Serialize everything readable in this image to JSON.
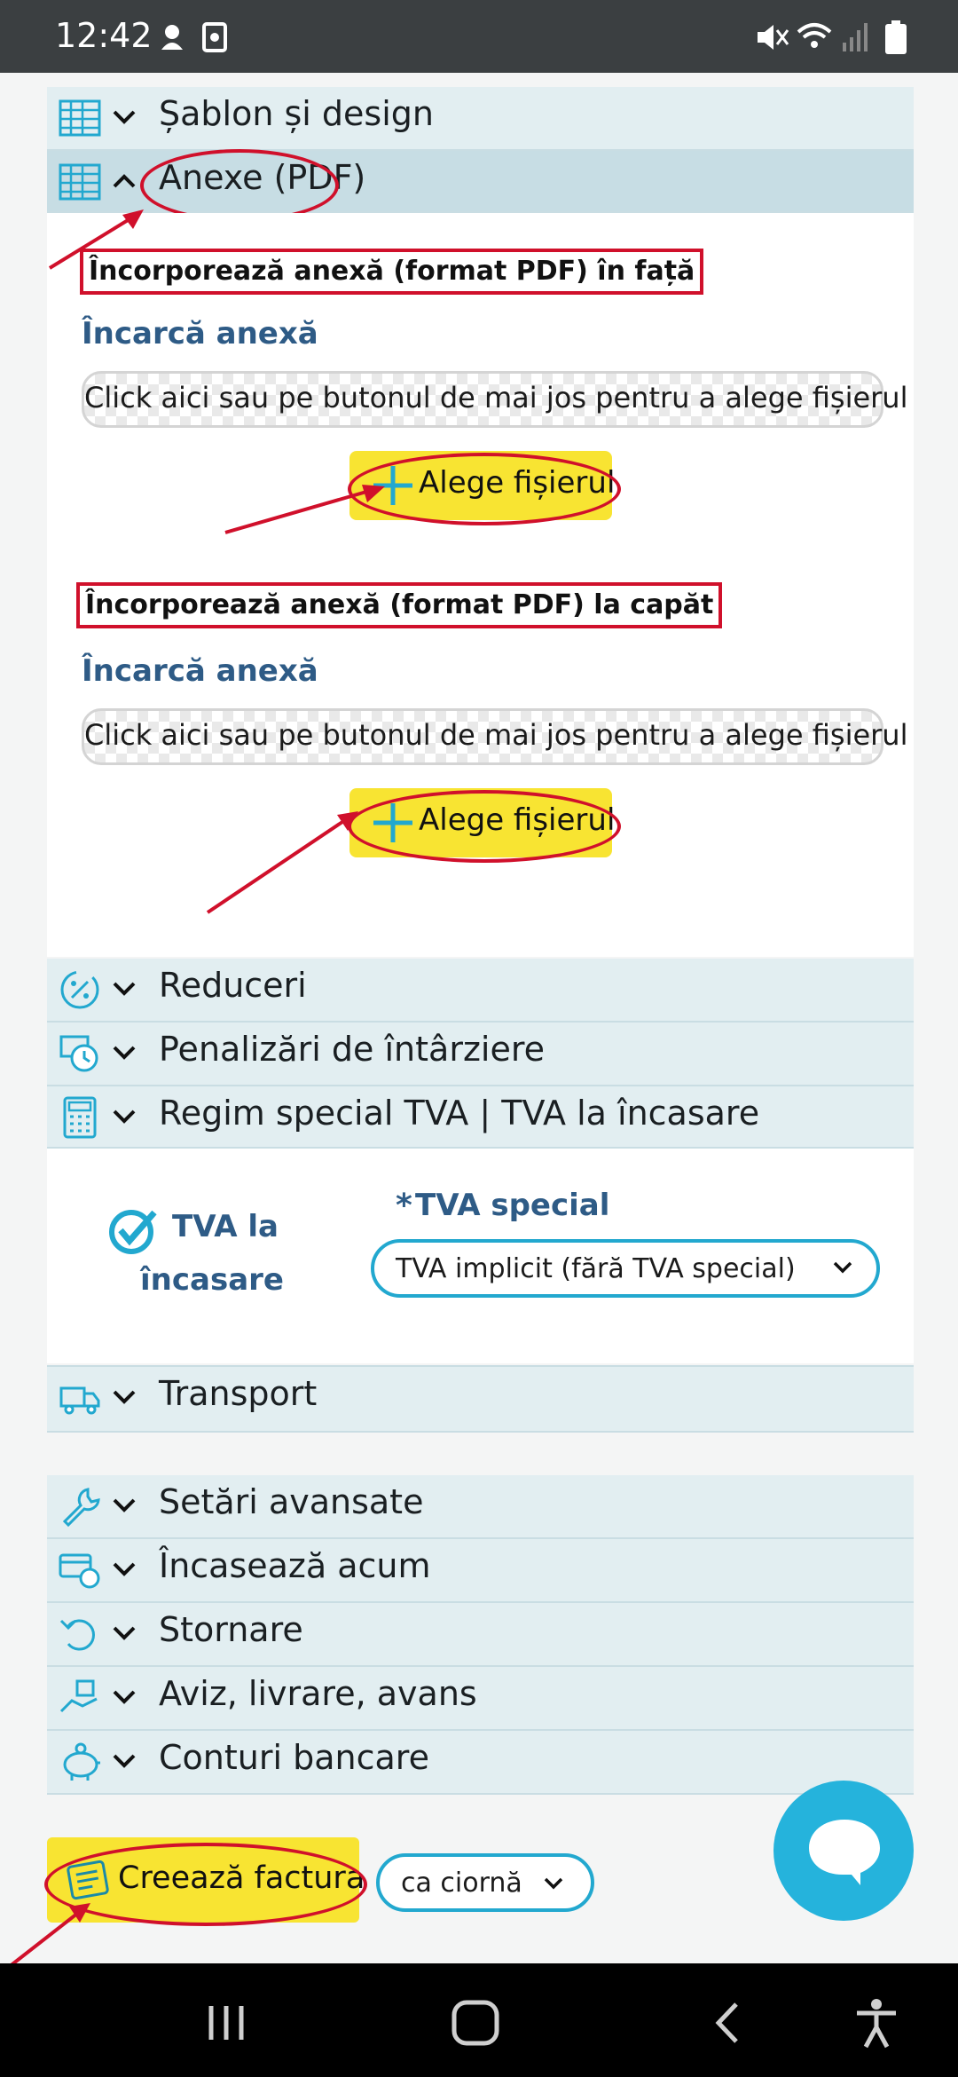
{
  "status_bar": {
    "time": "12:42"
  },
  "sections_top": [
    {
      "label": "Șablon și design",
      "icon": "table-icon"
    },
    {
      "label": "Anexe (PDF)",
      "icon": "table-icon"
    }
  ],
  "anexe": {
    "front_heading": "Încorporează anexă (format PDF) în față",
    "front_upload_label": "Încarcă anexă",
    "front_drop_text": "Click aici sau pe butonul de mai jos pentru a alege fișierul",
    "front_choose_button": "Alege fișierul",
    "end_heading": "Încorporează anexă (format PDF) la capăt",
    "end_upload_label": "Încarcă anexă",
    "end_drop_text": "Click aici sau pe butonul de mai jos pentru a alege fișierul",
    "end_choose_button": "Alege fișierul"
  },
  "sections_mid": [
    {
      "label": "Reduceri",
      "icon": "discount-icon"
    },
    {
      "label": "Penalizări de întârziere",
      "icon": "clock-money-icon"
    },
    {
      "label": "Regim special TVA | TVA la încasare",
      "icon": "calculator-icon"
    }
  ],
  "tva": {
    "checkbox_label_line1": "TVA la",
    "checkbox_label_line2": "încasare",
    "special_label_star": "*",
    "special_label": "TVA special",
    "special_value": "TVA implicit (fără TVA special)"
  },
  "transport": {
    "label": "Transport",
    "icon": "truck-icon"
  },
  "sections_bottom": [
    {
      "label": "Setări avansate",
      "icon": "wrench-icon"
    },
    {
      "label": "Încasează acum",
      "icon": "card-coin-icon"
    },
    {
      "label": "Stornare",
      "icon": "undo-icon"
    },
    {
      "label": "Aviz, livrare, avans",
      "icon": "delivery-icon"
    },
    {
      "label": "Conturi bancare",
      "icon": "piggy-bank-icon"
    }
  ],
  "footer": {
    "create_button": "Creează factura",
    "mode_select": "ca ciornă"
  },
  "colors": {
    "accent_blue": "#22a8cf",
    "highlight_yellow": "#f8e432",
    "annotation_red": "#d0102b",
    "row_bg": "#e2eef1",
    "label_blue": "#2e5b86"
  }
}
